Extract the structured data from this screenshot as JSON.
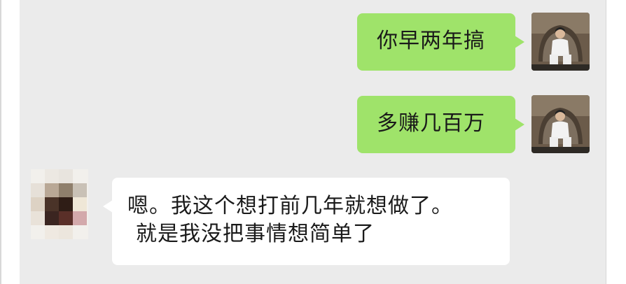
{
  "messages": [
    {
      "sender": "self",
      "text": "你早两年搞"
    },
    {
      "sender": "self",
      "text": "多赚几百万"
    },
    {
      "sender": "other",
      "lines": [
        "嗯。我这个想打前几年就想做了。",
        "就是我没把事情想简单了"
      ]
    }
  ],
  "colors": {
    "chat_background": "#ebebeb",
    "self_bubble": "#9fe36a",
    "other_bubble": "#ffffff"
  },
  "avatars": {
    "self": "photo-avatar-man-in-white-suit-on-throne-chair",
    "other": "pixelated-avatar"
  }
}
